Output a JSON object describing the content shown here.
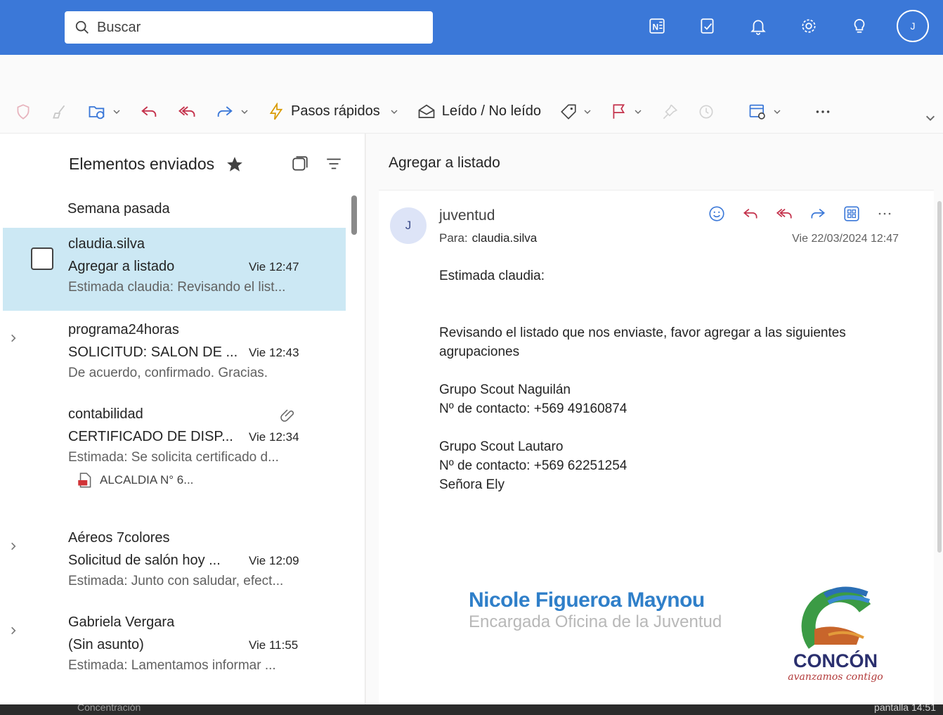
{
  "search": {
    "placeholder": "Buscar"
  },
  "header": {
    "avatar_initial": "J"
  },
  "ribbon": {
    "quick_steps_label": "Pasos rápidos",
    "read_unread_label": "Leído / No leído"
  },
  "folder": {
    "title": "Elementos enviados",
    "group_label": "Semana pasada"
  },
  "messages": [
    {
      "sender": "claudia.silva",
      "subject": "Agregar a listado",
      "time": "Vie 12:47",
      "preview": "Estimada claudia: Revisando el list..."
    },
    {
      "sender": "programa24horas",
      "subject": "SOLICITUD: SALON DE ...",
      "time": "Vie 12:43",
      "preview": "De acuerdo, confirmado. Gracias."
    },
    {
      "sender": "contabilidad",
      "subject": "CERTIFICADO DE DISP...",
      "time": "Vie 12:34",
      "preview": "Estimada: Se solicita certificado d...",
      "attachment": "ALCALDIA N° 6..."
    },
    {
      "sender": "Aéreos 7colores",
      "subject": "Solicitud de salón hoy ...",
      "time": "Vie 12:09",
      "preview": "Estimada: Junto con saludar, efect..."
    },
    {
      "sender": "Gabriela Vergara",
      "subject": "(Sin asunto)",
      "time": "Vie 11:55",
      "preview": "Estimada: Lamentamos informar ..."
    }
  ],
  "reading": {
    "conversation_title": "Agregar a listado",
    "avatar_initial": "J",
    "from": "juventud",
    "to_label": "Para:",
    "to": "claudia.silva",
    "date": "Vie 22/03/2024 12:47",
    "body": {
      "greeting": "Estimada claudia:",
      "line1": "Revisando el listado que nos enviaste, favor agregar a las siguientes",
      "line2": "agrupaciones",
      "group1_name": "Grupo Scout Naguilán",
      "group1_contact": "Nº de contacto: +569  49160874",
      "group2_name": "Grupo Scout Lautaro",
      "group2_contact": "Nº de contacto: +569 62251254",
      "group2_person": "Señora Ely"
    },
    "signature": {
      "name": "Nicole Figueroa Maynou",
      "role": "Encargada Oficina de la Juventud",
      "logo_text": "CONCÓN",
      "logo_slogan": "avanzamos contigo"
    }
  },
  "taskbar": {
    "left_text": "Concentración",
    "right_text": "pantalla  14:51"
  },
  "colors": {
    "header_blue": "#3b78d8",
    "selected_row": "#cce8f4",
    "signature_blue": "#2f7fc9"
  }
}
